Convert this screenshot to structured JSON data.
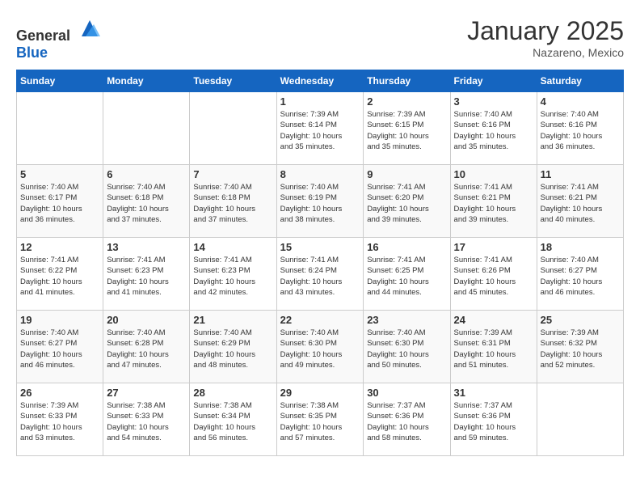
{
  "header": {
    "logo_general": "General",
    "logo_blue": "Blue",
    "month": "January 2025",
    "location": "Nazareno, Mexico"
  },
  "weekdays": [
    "Sunday",
    "Monday",
    "Tuesday",
    "Wednesday",
    "Thursday",
    "Friday",
    "Saturday"
  ],
  "weeks": [
    [
      {
        "day": "",
        "info": ""
      },
      {
        "day": "",
        "info": ""
      },
      {
        "day": "",
        "info": ""
      },
      {
        "day": "1",
        "info": "Sunrise: 7:39 AM\nSunset: 6:14 PM\nDaylight: 10 hours\nand 35 minutes."
      },
      {
        "day": "2",
        "info": "Sunrise: 7:39 AM\nSunset: 6:15 PM\nDaylight: 10 hours\nand 35 minutes."
      },
      {
        "day": "3",
        "info": "Sunrise: 7:40 AM\nSunset: 6:16 PM\nDaylight: 10 hours\nand 35 minutes."
      },
      {
        "day": "4",
        "info": "Sunrise: 7:40 AM\nSunset: 6:16 PM\nDaylight: 10 hours\nand 36 minutes."
      }
    ],
    [
      {
        "day": "5",
        "info": "Sunrise: 7:40 AM\nSunset: 6:17 PM\nDaylight: 10 hours\nand 36 minutes."
      },
      {
        "day": "6",
        "info": "Sunrise: 7:40 AM\nSunset: 6:18 PM\nDaylight: 10 hours\nand 37 minutes."
      },
      {
        "day": "7",
        "info": "Sunrise: 7:40 AM\nSunset: 6:18 PM\nDaylight: 10 hours\nand 37 minutes."
      },
      {
        "day": "8",
        "info": "Sunrise: 7:40 AM\nSunset: 6:19 PM\nDaylight: 10 hours\nand 38 minutes."
      },
      {
        "day": "9",
        "info": "Sunrise: 7:41 AM\nSunset: 6:20 PM\nDaylight: 10 hours\nand 39 minutes."
      },
      {
        "day": "10",
        "info": "Sunrise: 7:41 AM\nSunset: 6:21 PM\nDaylight: 10 hours\nand 39 minutes."
      },
      {
        "day": "11",
        "info": "Sunrise: 7:41 AM\nSunset: 6:21 PM\nDaylight: 10 hours\nand 40 minutes."
      }
    ],
    [
      {
        "day": "12",
        "info": "Sunrise: 7:41 AM\nSunset: 6:22 PM\nDaylight: 10 hours\nand 41 minutes."
      },
      {
        "day": "13",
        "info": "Sunrise: 7:41 AM\nSunset: 6:23 PM\nDaylight: 10 hours\nand 41 minutes."
      },
      {
        "day": "14",
        "info": "Sunrise: 7:41 AM\nSunset: 6:23 PM\nDaylight: 10 hours\nand 42 minutes."
      },
      {
        "day": "15",
        "info": "Sunrise: 7:41 AM\nSunset: 6:24 PM\nDaylight: 10 hours\nand 43 minutes."
      },
      {
        "day": "16",
        "info": "Sunrise: 7:41 AM\nSunset: 6:25 PM\nDaylight: 10 hours\nand 44 minutes."
      },
      {
        "day": "17",
        "info": "Sunrise: 7:41 AM\nSunset: 6:26 PM\nDaylight: 10 hours\nand 45 minutes."
      },
      {
        "day": "18",
        "info": "Sunrise: 7:40 AM\nSunset: 6:27 PM\nDaylight: 10 hours\nand 46 minutes."
      }
    ],
    [
      {
        "day": "19",
        "info": "Sunrise: 7:40 AM\nSunset: 6:27 PM\nDaylight: 10 hours\nand 46 minutes."
      },
      {
        "day": "20",
        "info": "Sunrise: 7:40 AM\nSunset: 6:28 PM\nDaylight: 10 hours\nand 47 minutes."
      },
      {
        "day": "21",
        "info": "Sunrise: 7:40 AM\nSunset: 6:29 PM\nDaylight: 10 hours\nand 48 minutes."
      },
      {
        "day": "22",
        "info": "Sunrise: 7:40 AM\nSunset: 6:30 PM\nDaylight: 10 hours\nand 49 minutes."
      },
      {
        "day": "23",
        "info": "Sunrise: 7:40 AM\nSunset: 6:30 PM\nDaylight: 10 hours\nand 50 minutes."
      },
      {
        "day": "24",
        "info": "Sunrise: 7:39 AM\nSunset: 6:31 PM\nDaylight: 10 hours\nand 51 minutes."
      },
      {
        "day": "25",
        "info": "Sunrise: 7:39 AM\nSunset: 6:32 PM\nDaylight: 10 hours\nand 52 minutes."
      }
    ],
    [
      {
        "day": "26",
        "info": "Sunrise: 7:39 AM\nSunset: 6:33 PM\nDaylight: 10 hours\nand 53 minutes."
      },
      {
        "day": "27",
        "info": "Sunrise: 7:38 AM\nSunset: 6:33 PM\nDaylight: 10 hours\nand 54 minutes."
      },
      {
        "day": "28",
        "info": "Sunrise: 7:38 AM\nSunset: 6:34 PM\nDaylight: 10 hours\nand 56 minutes."
      },
      {
        "day": "29",
        "info": "Sunrise: 7:38 AM\nSunset: 6:35 PM\nDaylight: 10 hours\nand 57 minutes."
      },
      {
        "day": "30",
        "info": "Sunrise: 7:37 AM\nSunset: 6:36 PM\nDaylight: 10 hours\nand 58 minutes."
      },
      {
        "day": "31",
        "info": "Sunrise: 7:37 AM\nSunset: 6:36 PM\nDaylight: 10 hours\nand 59 minutes."
      },
      {
        "day": "",
        "info": ""
      }
    ]
  ]
}
